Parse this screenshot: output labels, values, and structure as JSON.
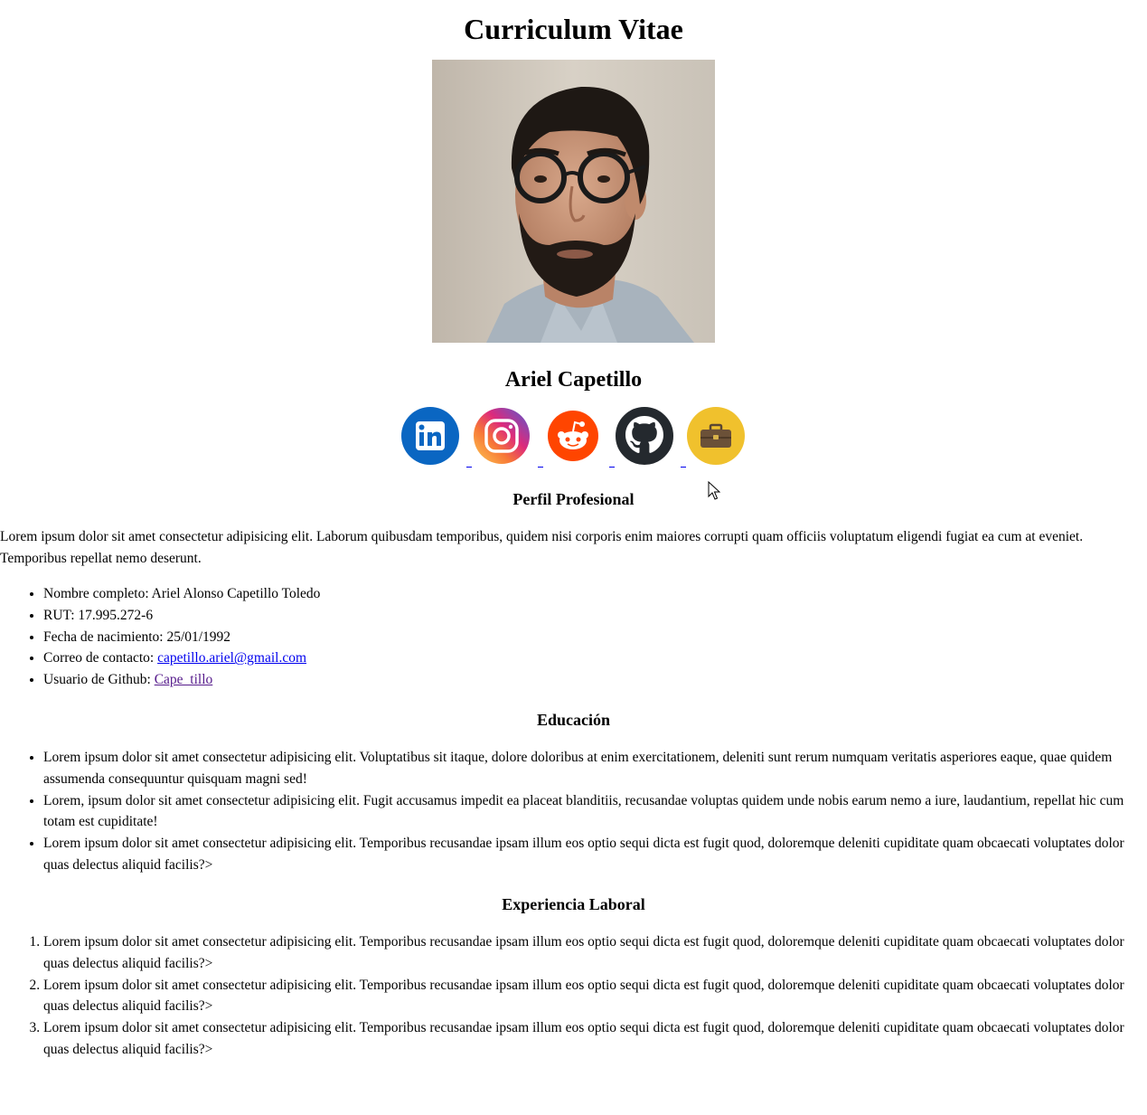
{
  "header": {
    "title": "Curriculum Vitae"
  },
  "profile": {
    "name": "Ariel Capetillo"
  },
  "social": [
    {
      "name": "linkedin-icon",
      "color": "#0a66c2"
    },
    {
      "name": "instagram-icon",
      "color": "#dd2a7b"
    },
    {
      "name": "reddit-icon",
      "color": "#ff4500"
    },
    {
      "name": "github-icon",
      "color": "#24292e"
    },
    {
      "name": "portfolio-icon",
      "color": "#f0c12d"
    }
  ],
  "perfil": {
    "heading": "Perfil Profesional",
    "paragraph": "Lorem ipsum dolor sit amet consectetur adipisicing elit. Laborum quibusdam temporibus, quidem nisi corporis enim maiores corrupti quam officiis voluptatum eligendi fugiat ea cum at eveniet. Temporibus repellat nemo deserunt.",
    "details": [
      {
        "label": "Nombre completo: ",
        "value": "Ariel Alonso Capetillo Toledo"
      },
      {
        "label": "RUT: ",
        "value": "17.995.272-6"
      },
      {
        "label": "Fecha de nacimiento: ",
        "value": "25/01/1992"
      },
      {
        "label": "Correo de contacto: ",
        "link": "capetillo.ariel@gmail.com"
      },
      {
        "label": "Usuario de Github: ",
        "link": "Cape_tillo"
      }
    ]
  },
  "educacion": {
    "heading": "Educación",
    "items": [
      "Lorem ipsum dolor sit amet consectetur adipisicing elit. Voluptatibus sit itaque, dolore doloribus at enim exercitationem, deleniti sunt rerum numquam veritatis asperiores eaque, quae quidem assumenda consequuntur quisquam magni sed!",
      "Lorem, ipsum dolor sit amet consectetur adipisicing elit. Fugit accusamus impedit ea placeat blanditiis, recusandae voluptas quidem unde nobis earum nemo a iure, laudantium, repellat hic cum totam est cupiditate!",
      "Lorem ipsum dolor sit amet consectetur adipisicing elit. Temporibus recusandae ipsam illum eos optio sequi dicta est fugit quod, doloremque deleniti cupiditate quam obcaecati voluptates dolor quas delectus aliquid facilis?>"
    ]
  },
  "experiencia": {
    "heading": "Experiencia Laboral",
    "items": [
      "Lorem ipsum dolor sit amet consectetur adipisicing elit. Temporibus recusandae ipsam illum eos optio sequi dicta est fugit quod, doloremque deleniti cupiditate quam obcaecati voluptates dolor quas delectus aliquid facilis?>",
      "Lorem ipsum dolor sit amet consectetur adipisicing elit. Temporibus recusandae ipsam illum eos optio sequi dicta est fugit quod, doloremque deleniti cupiditate quam obcaecati voluptates dolor quas delectus aliquid facilis?>",
      "Lorem ipsum dolor sit amet consectetur adipisicing elit. Temporibus recusandae ipsam illum eos optio sequi dicta est fugit quod, doloremque deleniti cupiditate quam obcaecati voluptates dolor quas delectus aliquid facilis?>"
    ]
  }
}
